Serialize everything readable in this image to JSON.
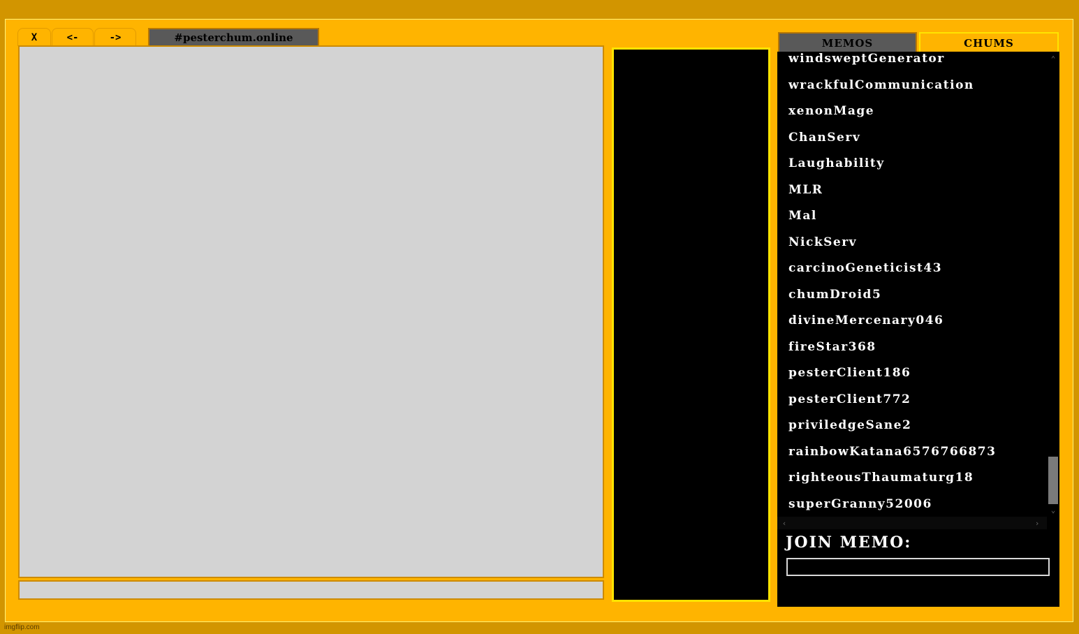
{
  "toolbar": {
    "close_label": "X",
    "back_label": "<-",
    "forward_label": "->"
  },
  "memo_tab": {
    "label": "#pesterchum.online"
  },
  "side_tabs": {
    "memos_label": "MEMOS",
    "chums_label": "CHUMS"
  },
  "memo_list": [
    "windsweptGenerator",
    "wrackfulCommunication",
    "xenonMage",
    "ChanServ",
    "Laughability",
    "MLR",
    "Mal",
    "NickServ",
    "carcinoGeneticist43",
    "chumDroid5",
    "divineMercenary046",
    "fireStar368",
    "pesterClient186",
    "pesterClient772",
    "priviledgeSane2",
    "rainbowKatana6576766873",
    "righteousThaumaturg18",
    "superGranny52006"
  ],
  "join_memo": {
    "label": "JOIN MEMO:",
    "value": ""
  },
  "watermark": "imgflip.com",
  "colors": {
    "background": "#ffb400",
    "outer": "#d29500",
    "panel": "#000000",
    "chat_area": "#d3d3d3",
    "accent_border": "#ffe400"
  }
}
